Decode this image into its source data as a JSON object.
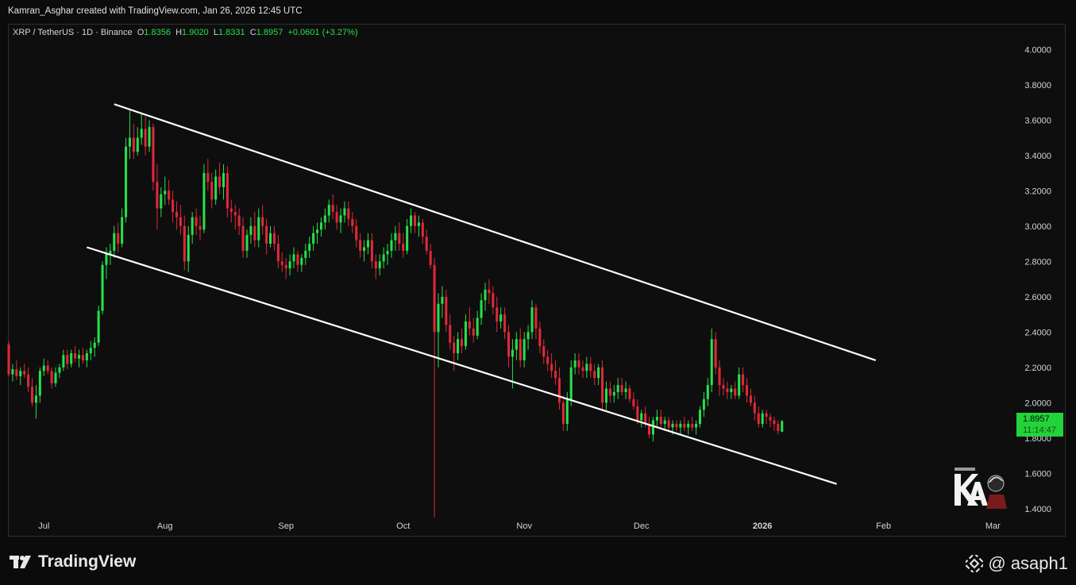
{
  "header": {
    "credit": "Kamran_Asghar created with TradingView.com, Jan 26, 2026 12:45 UTC"
  },
  "legend": {
    "symbol": "XRP / TetherUS · 1D · Binance",
    "o_label": "O",
    "o_value": "1.8356",
    "h_label": "H",
    "h_value": "1.9020",
    "l_label": "L",
    "l_value": "1.8331",
    "c_label": "C",
    "c_value": "1.8957",
    "change": "+0.0601 (+3.27%)"
  },
  "price_tag": {
    "price": "1.8957",
    "countdown": "11:14:47"
  },
  "footer": {
    "brand": "TradingView",
    "handle": "@ asaph1"
  },
  "colors": {
    "up": "#26e04a",
    "down": "#e0283a",
    "background": "#0e0e0e",
    "channel": "#ffffff"
  },
  "chart_data": {
    "type": "candlestick",
    "y_ticks": [
      "4.0000",
      "3.8000",
      "3.6000",
      "3.4000",
      "3.2000",
      "3.0000",
      "2.8000",
      "2.6000",
      "2.4000",
      "2.2000",
      "2.0000",
      "1.8000",
      "1.6000",
      "1.4000"
    ],
    "ylim": [
      1.35,
      4.1
    ],
    "xlim": [
      "2025-06-22",
      "2026-03-05"
    ],
    "x_ticks": [
      {
        "label": "Jul",
        "date": "2025-07-01"
      },
      {
        "label": "Aug",
        "date": "2025-08-01"
      },
      {
        "label": "Sep",
        "date": "2025-09-01"
      },
      {
        "label": "Oct",
        "date": "2025-10-01"
      },
      {
        "label": "Nov",
        "date": "2025-11-01"
      },
      {
        "label": "Dec",
        "date": "2025-12-01"
      },
      {
        "label": "2026",
        "date": "2026-01-01"
      },
      {
        "label": "Feb",
        "date": "2026-02-01"
      },
      {
        "label": "Mar",
        "date": "2026-03-01"
      }
    ],
    "start_date": "2025-06-22",
    "candles": [
      [
        2.33,
        2.35,
        2.15,
        2.16
      ],
      [
        2.16,
        2.22,
        2.12,
        2.19
      ],
      [
        2.19,
        2.24,
        2.13,
        2.15
      ],
      [
        2.15,
        2.2,
        2.1,
        2.18
      ],
      [
        2.18,
        2.22,
        2.14,
        2.16
      ],
      [
        2.16,
        2.2,
        2.06,
        2.09
      ],
      [
        2.09,
        2.14,
        1.98,
        2.0
      ],
      [
        2.0,
        2.1,
        1.91,
        2.04
      ],
      [
        2.04,
        2.2,
        2.0,
        2.18
      ],
      [
        2.18,
        2.25,
        2.15,
        2.21
      ],
      [
        2.21,
        2.24,
        2.16,
        2.18
      ],
      [
        2.18,
        2.2,
        2.08,
        2.11
      ],
      [
        2.11,
        2.2,
        2.09,
        2.17
      ],
      [
        2.17,
        2.22,
        2.14,
        2.2
      ],
      [
        2.2,
        2.3,
        2.18,
        2.27
      ],
      [
        2.27,
        2.3,
        2.19,
        2.22
      ],
      [
        2.22,
        2.3,
        2.2,
        2.28
      ],
      [
        2.28,
        2.32,
        2.23,
        2.25
      ],
      [
        2.25,
        2.3,
        2.2,
        2.27
      ],
      [
        2.27,
        2.31,
        2.22,
        2.24
      ],
      [
        2.24,
        2.3,
        2.2,
        2.28
      ],
      [
        2.28,
        2.35,
        2.24,
        2.31
      ],
      [
        2.31,
        2.37,
        2.26,
        2.34
      ],
      [
        2.34,
        2.55,
        2.32,
        2.52
      ],
      [
        2.52,
        2.8,
        2.5,
        2.78
      ],
      [
        2.78,
        2.88,
        2.7,
        2.84
      ],
      [
        2.84,
        2.9,
        2.78,
        2.86
      ],
      [
        2.86,
        3.0,
        2.82,
        2.96
      ],
      [
        2.96,
        3.02,
        2.85,
        2.9
      ],
      [
        2.9,
        3.1,
        2.88,
        3.05
      ],
      [
        3.05,
        3.5,
        3.02,
        3.45
      ],
      [
        3.45,
        3.66,
        3.38,
        3.5
      ],
      [
        3.5,
        3.58,
        3.38,
        3.42
      ],
      [
        3.42,
        3.56,
        3.4,
        3.5
      ],
      [
        3.5,
        3.64,
        3.46,
        3.55
      ],
      [
        3.55,
        3.62,
        3.4,
        3.45
      ],
      [
        3.45,
        3.6,
        3.42,
        3.56
      ],
      [
        3.56,
        3.58,
        3.2,
        3.25
      ],
      [
        3.25,
        3.35,
        2.98,
        3.1
      ],
      [
        3.1,
        3.22,
        3.05,
        3.18
      ],
      [
        3.18,
        3.28,
        3.12,
        3.2
      ],
      [
        3.2,
        3.26,
        3.12,
        3.15
      ],
      [
        3.15,
        3.2,
        3.02,
        3.08
      ],
      [
        3.08,
        3.14,
        2.98,
        3.05
      ],
      [
        3.05,
        3.12,
        2.95,
        3.0
      ],
      [
        3.0,
        3.06,
        2.75,
        2.8
      ],
      [
        2.8,
        3.0,
        2.74,
        2.95
      ],
      [
        2.95,
        3.08,
        2.9,
        3.05
      ],
      [
        3.05,
        3.1,
        2.95,
        3.0
      ],
      [
        3.0,
        3.06,
        2.92,
        2.98
      ],
      [
        2.98,
        3.35,
        2.96,
        3.3
      ],
      [
        3.3,
        3.38,
        3.2,
        3.25
      ],
      [
        3.25,
        3.3,
        3.1,
        3.15
      ],
      [
        3.15,
        3.32,
        3.12,
        3.28
      ],
      [
        3.28,
        3.36,
        3.18,
        3.22
      ],
      [
        3.22,
        3.35,
        3.15,
        3.3
      ],
      [
        3.3,
        3.34,
        3.05,
        3.1
      ],
      [
        3.1,
        3.15,
        3.02,
        3.08
      ],
      [
        3.08,
        3.12,
        2.98,
        3.06
      ],
      [
        3.06,
        3.1,
        2.95,
        3.0
      ],
      [
        3.0,
        3.05,
        2.82,
        2.86
      ],
      [
        2.86,
        2.98,
        2.82,
        2.95
      ],
      [
        2.95,
        3.05,
        2.9,
        3.0
      ],
      [
        3.0,
        3.08,
        2.88,
        2.92
      ],
      [
        2.92,
        3.1,
        2.88,
        3.05
      ],
      [
        3.05,
        3.12,
        2.95,
        3.0
      ],
      [
        3.0,
        3.04,
        2.84,
        2.9
      ],
      [
        2.9,
        3.0,
        2.88,
        2.96
      ],
      [
        2.96,
        3.0,
        2.86,
        2.9
      ],
      [
        2.9,
        2.95,
        2.76,
        2.8
      ],
      [
        2.8,
        2.85,
        2.74,
        2.78
      ],
      [
        2.78,
        2.82,
        2.7,
        2.76
      ],
      [
        2.76,
        2.84,
        2.72,
        2.8
      ],
      [
        2.8,
        2.88,
        2.76,
        2.84
      ],
      [
        2.84,
        2.86,
        2.74,
        2.78
      ],
      [
        2.78,
        2.84,
        2.74,
        2.82
      ],
      [
        2.82,
        2.9,
        2.78,
        2.86
      ],
      [
        2.86,
        2.94,
        2.82,
        2.9
      ],
      [
        2.9,
        3.0,
        2.86,
        2.96
      ],
      [
        2.96,
        3.02,
        2.9,
        2.98
      ],
      [
        2.98,
        3.05,
        2.94,
        3.02
      ],
      [
        3.02,
        3.1,
        2.98,
        3.06
      ],
      [
        3.06,
        3.15,
        3.02,
        3.12
      ],
      [
        3.12,
        3.18,
        3.04,
        3.08
      ],
      [
        3.08,
        3.12,
        2.98,
        3.02
      ],
      [
        3.02,
        3.1,
        2.96,
        3.06
      ],
      [
        3.06,
        3.14,
        3.02,
        3.1
      ],
      [
        3.1,
        3.14,
        3.0,
        3.04
      ],
      [
        3.04,
        3.08,
        2.96,
        3.0
      ],
      [
        3.0,
        3.04,
        2.88,
        2.92
      ],
      [
        2.92,
        2.96,
        2.82,
        2.86
      ],
      [
        2.86,
        2.92,
        2.8,
        2.88
      ],
      [
        2.88,
        2.96,
        2.84,
        2.92
      ],
      [
        2.92,
        2.96,
        2.76,
        2.8
      ],
      [
        2.8,
        2.84,
        2.7,
        2.76
      ],
      [
        2.76,
        2.84,
        2.72,
        2.8
      ],
      [
        2.8,
        2.88,
        2.76,
        2.84
      ],
      [
        2.84,
        2.9,
        2.78,
        2.86
      ],
      [
        2.86,
        2.96,
        2.82,
        2.92
      ],
      [
        2.92,
        3.0,
        2.86,
        2.96
      ],
      [
        2.96,
        3.02,
        2.86,
        2.9
      ],
      [
        2.9,
        2.96,
        2.82,
        2.86
      ],
      [
        2.86,
        3.04,
        2.84,
        3.0
      ],
      [
        3.0,
        3.1,
        2.96,
        3.06
      ],
      [
        3.06,
        3.08,
        2.96,
        3.0
      ],
      [
        3.0,
        3.06,
        2.94,
        3.02
      ],
      [
        3.02,
        3.04,
        2.9,
        2.94
      ],
      [
        2.94,
        2.98,
        2.84,
        2.86
      ],
      [
        2.86,
        2.9,
        2.76,
        2.78
      ],
      [
        2.78,
        2.82,
        1.35,
        2.4
      ],
      [
        2.4,
        2.62,
        2.2,
        2.56
      ],
      [
        2.56,
        2.66,
        2.48,
        2.6
      ],
      [
        2.6,
        2.64,
        2.4,
        2.44
      ],
      [
        2.44,
        2.5,
        2.3,
        2.34
      ],
      [
        2.34,
        2.38,
        2.18,
        2.28
      ],
      [
        2.28,
        2.4,
        2.24,
        2.36
      ],
      [
        2.36,
        2.42,
        2.28,
        2.32
      ],
      [
        2.32,
        2.5,
        2.3,
        2.46
      ],
      [
        2.46,
        2.54,
        2.38,
        2.42
      ],
      [
        2.42,
        2.48,
        2.34,
        2.38
      ],
      [
        2.38,
        2.52,
        2.36,
        2.48
      ],
      [
        2.48,
        2.62,
        2.44,
        2.58
      ],
      [
        2.58,
        2.68,
        2.52,
        2.64
      ],
      [
        2.64,
        2.7,
        2.56,
        2.62
      ],
      [
        2.62,
        2.66,
        2.5,
        2.54
      ],
      [
        2.54,
        2.6,
        2.4,
        2.46
      ],
      [
        2.46,
        2.54,
        2.42,
        2.5
      ],
      [
        2.5,
        2.54,
        2.36,
        2.4
      ],
      [
        2.4,
        2.44,
        2.2,
        2.26
      ],
      [
        2.26,
        2.36,
        2.08,
        2.3
      ],
      [
        2.3,
        2.4,
        2.24,
        2.36
      ],
      [
        2.36,
        2.42,
        2.2,
        2.24
      ],
      [
        2.24,
        2.4,
        2.2,
        2.36
      ],
      [
        2.36,
        2.44,
        2.3,
        2.4
      ],
      [
        2.4,
        2.58,
        2.36,
        2.54
      ],
      [
        2.54,
        2.56,
        2.36,
        2.42
      ],
      [
        2.42,
        2.46,
        2.28,
        2.32
      ],
      [
        2.32,
        2.36,
        2.22,
        2.26
      ],
      [
        2.26,
        2.3,
        2.18,
        2.22
      ],
      [
        2.22,
        2.28,
        2.14,
        2.18
      ],
      [
        2.18,
        2.24,
        2.1,
        2.14
      ],
      [
        2.14,
        2.2,
        1.96,
        2.0
      ],
      [
        2.0,
        2.04,
        1.84,
        1.88
      ],
      [
        1.88,
        2.06,
        1.84,
        2.02
      ],
      [
        2.02,
        2.24,
        1.98,
        2.2
      ],
      [
        2.2,
        2.28,
        2.16,
        2.24
      ],
      [
        2.24,
        2.28,
        2.16,
        2.2
      ],
      [
        2.2,
        2.24,
        2.14,
        2.18
      ],
      [
        2.18,
        2.26,
        2.14,
        2.22
      ],
      [
        2.22,
        2.26,
        2.14,
        2.18
      ],
      [
        2.18,
        2.22,
        2.1,
        2.14
      ],
      [
        2.14,
        2.22,
        2.1,
        2.2
      ],
      [
        2.2,
        2.24,
        1.96,
        2.0
      ],
      [
        2.0,
        2.12,
        1.96,
        2.08
      ],
      [
        2.08,
        2.12,
        2.0,
        2.04
      ],
      [
        2.04,
        2.1,
        2.0,
        2.06
      ],
      [
        2.06,
        2.14,
        2.02,
        2.1
      ],
      [
        2.1,
        2.14,
        2.04,
        2.06
      ],
      [
        2.06,
        2.12,
        2.02,
        2.08
      ],
      [
        2.08,
        2.1,
        2.0,
        2.02
      ],
      [
        2.02,
        2.06,
        1.96,
        1.98
      ],
      [
        1.98,
        2.02,
        1.88,
        1.9
      ],
      [
        1.9,
        1.96,
        1.86,
        1.94
      ],
      [
        1.94,
        1.98,
        1.86,
        1.88
      ],
      [
        1.88,
        1.92,
        1.8,
        1.82
      ],
      [
        1.82,
        1.92,
        1.78,
        1.9
      ],
      [
        1.9,
        1.96,
        1.86,
        1.92
      ],
      [
        1.92,
        1.96,
        1.86,
        1.88
      ],
      [
        1.88,
        1.92,
        1.84,
        1.9
      ],
      [
        1.9,
        1.92,
        1.84,
        1.86
      ],
      [
        1.86,
        1.9,
        1.82,
        1.88
      ],
      [
        1.88,
        1.9,
        1.84,
        1.86
      ],
      [
        1.86,
        1.9,
        1.82,
        1.88
      ],
      [
        1.88,
        1.92,
        1.84,
        1.86
      ],
      [
        1.86,
        1.9,
        1.82,
        1.88
      ],
      [
        1.88,
        1.92,
        1.84,
        1.86
      ],
      [
        1.86,
        1.9,
        1.82,
        1.88
      ],
      [
        1.88,
        1.98,
        1.86,
        1.96
      ],
      [
        1.96,
        2.06,
        1.92,
        2.02
      ],
      [
        2.02,
        2.14,
        1.98,
        2.1
      ],
      [
        2.1,
        2.42,
        2.06,
        2.36
      ],
      [
        2.36,
        2.4,
        2.16,
        2.2
      ],
      [
        2.2,
        2.24,
        2.04,
        2.1
      ],
      [
        2.1,
        2.14,
        2.04,
        2.08
      ],
      [
        2.08,
        2.12,
        2.02,
        2.06
      ],
      [
        2.06,
        2.1,
        2.02,
        2.08
      ],
      [
        2.08,
        2.12,
        2.02,
        2.04
      ],
      [
        2.04,
        2.2,
        2.02,
        2.16
      ],
      [
        2.16,
        2.2,
        2.06,
        2.1
      ],
      [
        2.1,
        2.14,
        2.0,
        2.04
      ],
      [
        2.04,
        2.08,
        1.98,
        2.0
      ],
      [
        2.0,
        2.04,
        1.9,
        1.94
      ],
      [
        1.94,
        1.98,
        1.86,
        1.88
      ],
      [
        1.88,
        1.96,
        1.86,
        1.94
      ],
      [
        1.94,
        1.96,
        1.88,
        1.92
      ],
      [
        1.92,
        1.94,
        1.86,
        1.9
      ],
      [
        1.9,
        1.92,
        1.84,
        1.88
      ],
      [
        1.88,
        1.9,
        1.82,
        1.84
      ],
      [
        1.8356,
        1.902,
        1.8331,
        1.8957
      ]
    ],
    "channel_lines": [
      {
        "name": "upper",
        "x1": "2025-07-19",
        "y1": 3.69,
        "x2": "2026-01-30",
        "y2": 2.24
      },
      {
        "name": "lower",
        "x1": "2025-07-12",
        "y1": 2.88,
        "x2": "2026-01-20",
        "y2": 1.54
      }
    ]
  }
}
